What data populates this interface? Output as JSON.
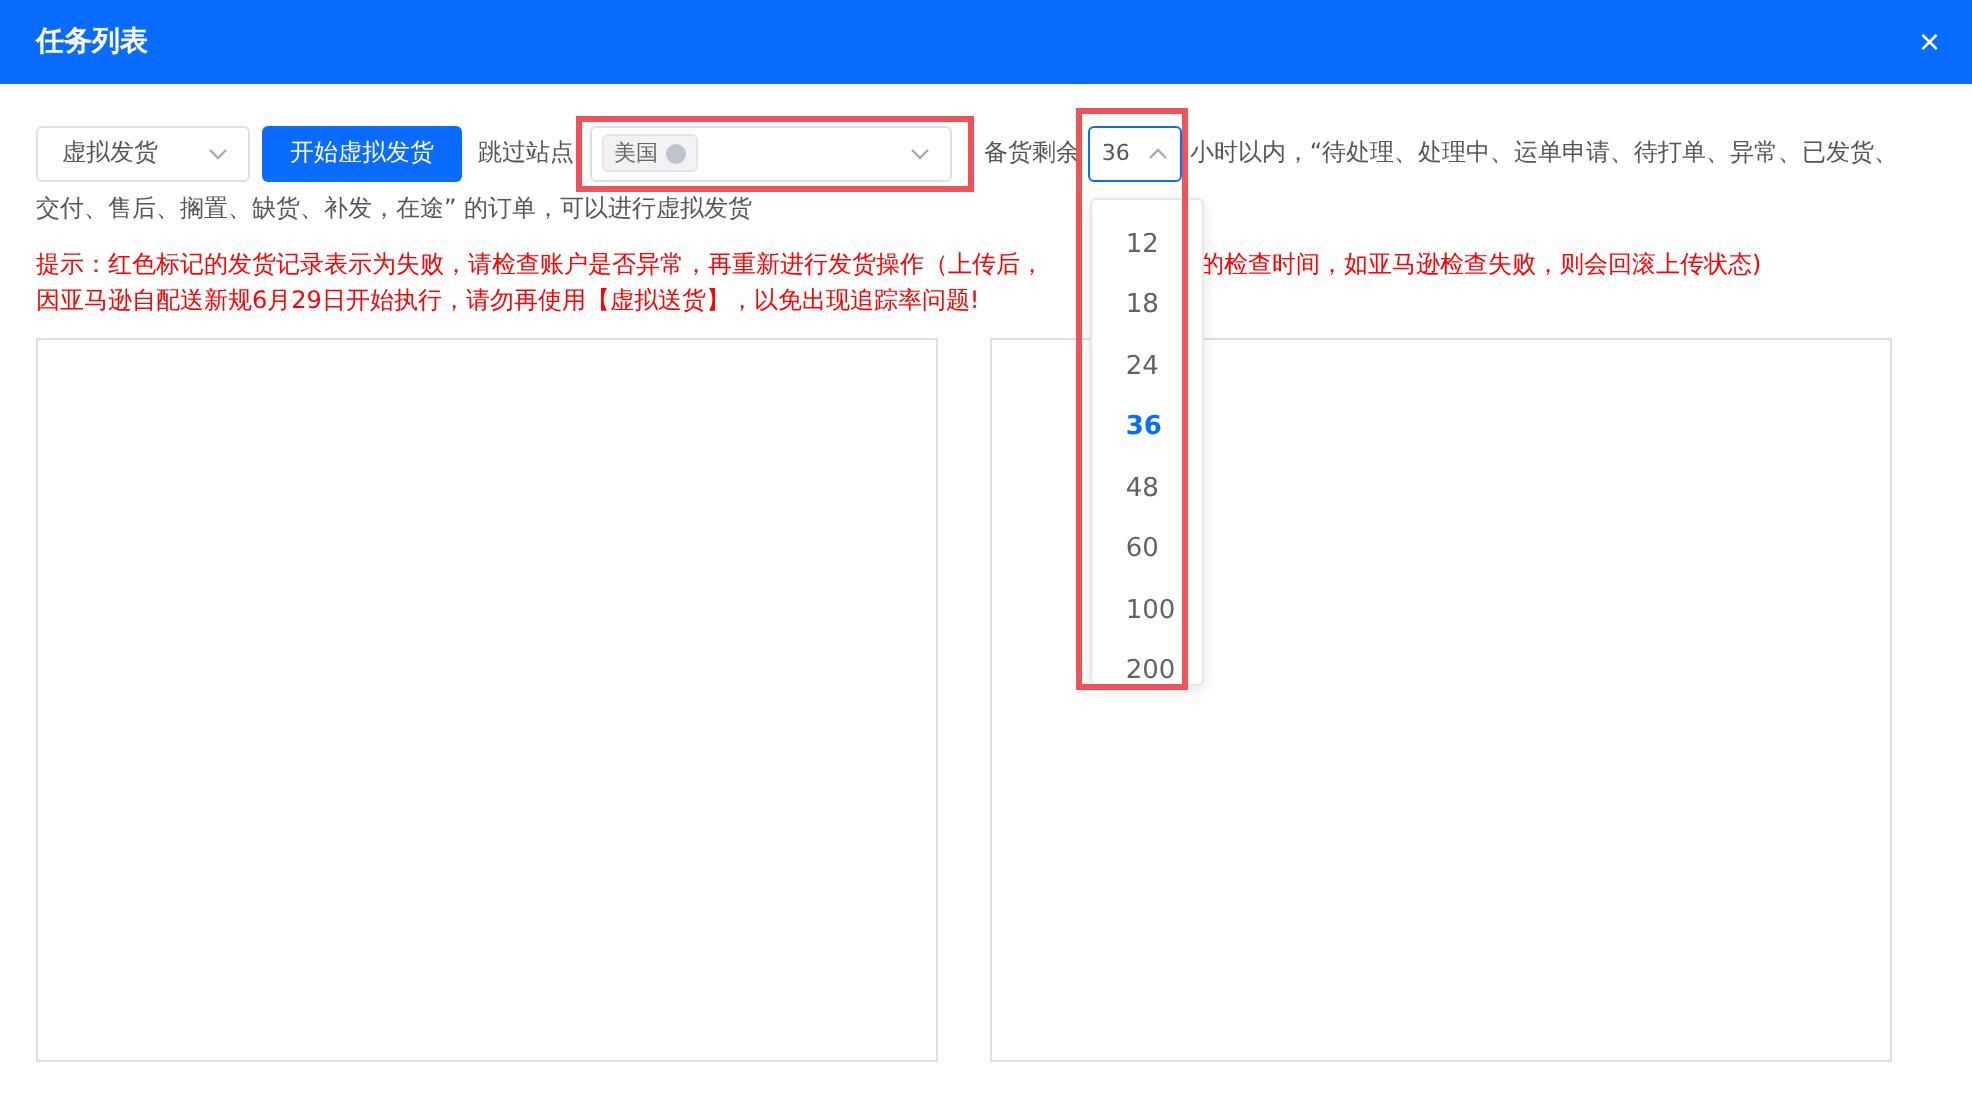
{
  "window": {
    "title": "任务列表",
    "close": "×"
  },
  "toolbar": {
    "mode_select": {
      "value": "虚拟发货"
    },
    "start_button": "开始虚拟发货",
    "skip_label": "跳过站点",
    "skip_select": {
      "tags": [
        "美国"
      ],
      "highlighted": true
    },
    "stock_label": "备货剩余",
    "hours_select": {
      "value": "36",
      "open": true,
      "highlighted": true,
      "options": [
        {
          "label": "12",
          "selected": false
        },
        {
          "label": "18",
          "selected": false
        },
        {
          "label": "24",
          "selected": false
        },
        {
          "label": "36",
          "selected": true
        },
        {
          "label": "48",
          "selected": false
        },
        {
          "label": "60",
          "selected": false
        },
        {
          "label": "100",
          "selected": false
        },
        {
          "label": "200",
          "selected": false
        }
      ]
    },
    "description": [
      "小时以内，“待处理、处理中、运单申请、待打单、异常、已发货、",
      "交付、售后、搁置、缺货、补发，在途” 的订单，可以进行虚拟发货"
    ]
  },
  "hints": [
    {
      "parts": [
        "提示：红色标记的发货记录表示为失败，请检查账户是否异常，再重新进行发货操作（上传后，",
        "的检查时间，如亚马逊检查失败，则会回滚上传状态)"
      ]
    },
    {
      "parts": [
        "因亚马逊自配送新规6月29日开始执行，请勿再使用【虚拟送货】，以免出现追踪率问题!"
      ]
    }
  ],
  "panels": [
    {
      "kind": "list"
    },
    {
      "kind": "list"
    }
  ]
}
